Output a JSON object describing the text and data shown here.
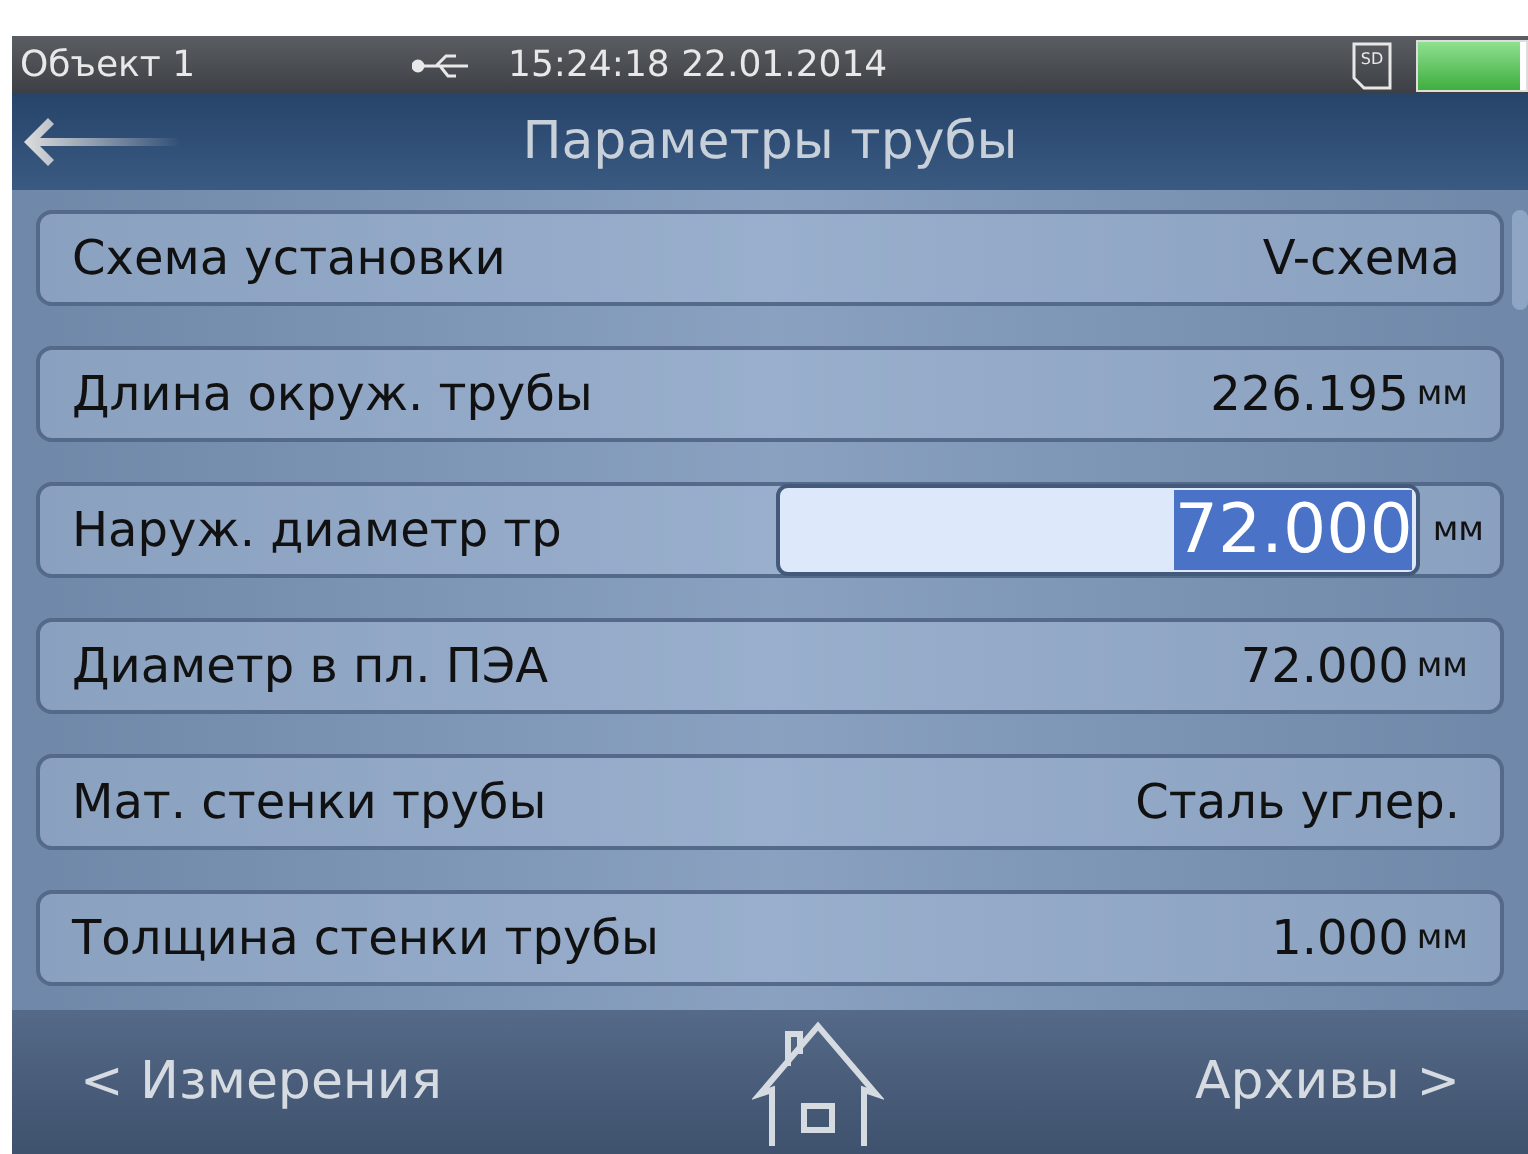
{
  "status_bar": {
    "object": "Объект 1",
    "time": "15:24:18",
    "date": "22.01.2014",
    "sd": "SD",
    "battery": {
      "level": 0.95
    }
  },
  "header": {
    "title": "Параметры трубы"
  },
  "rows": [
    {
      "kind": "value",
      "label": "Схема установки",
      "value": "V-схема"
    },
    {
      "kind": "value",
      "label": "Длина окруж. трубы",
      "value": "226.195",
      "unit": "мм"
    },
    {
      "kind": "edit",
      "label": "Наруж. диаметр тр",
      "value": "72.000",
      "unit": "мм"
    },
    {
      "kind": "value",
      "label": "Диаметр в пл. ПЭА",
      "value": "72.000",
      "unit": "мм"
    },
    {
      "kind": "value",
      "label": "Мат. стенки трубы",
      "value": "Сталь углер."
    },
    {
      "kind": "value",
      "label": "Толщина стенки трубы",
      "value": "1.000",
      "unit": "мм"
    }
  ],
  "footer": {
    "left": "< Измерения",
    "right": "Архивы >"
  }
}
